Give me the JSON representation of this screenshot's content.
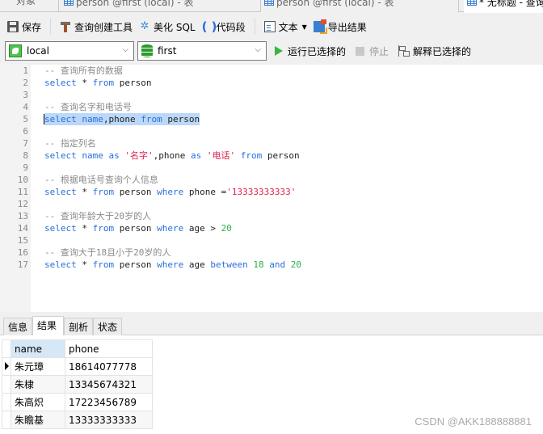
{
  "window_tabs": [
    {
      "label": "对象",
      "active": false
    },
    {
      "label": "person @first (local) - 表",
      "icon": "table-edit-icon",
      "active": false
    },
    {
      "label": "person @first (local) - 表",
      "icon": "table-icon",
      "active": false
    },
    {
      "label": "* 无标题 - 查询",
      "icon": "query-table-icon",
      "active": true
    }
  ],
  "toolbar": {
    "save": "保存",
    "query_builder": "查询创建工具",
    "beautify_sql": "美化 SQL",
    "code_snippet": "代码段",
    "text": "文本",
    "export_results": "导出结果"
  },
  "connection_bar": {
    "connection": "local",
    "database": "first",
    "run_selected": "运行已选择的",
    "stop": "停止",
    "explain_selected": "解释已选择的"
  },
  "editor": {
    "lines": [
      {
        "n": "1",
        "tokens": [
          {
            "t": "-- 查询所有的数据",
            "c": "cm"
          }
        ]
      },
      {
        "n": "2",
        "tokens": [
          {
            "t": "select",
            "c": "kw"
          },
          {
            "t": " * ",
            "c": "op"
          },
          {
            "t": "from",
            "c": "kw"
          },
          {
            "t": " person",
            "c": "id"
          }
        ]
      },
      {
        "n": "3",
        "tokens": []
      },
      {
        "n": "4",
        "tokens": [
          {
            "t": "-- 查询名字和电话号",
            "c": "cm"
          }
        ]
      },
      {
        "n": "5",
        "selected": true,
        "tokens": [
          {
            "t": "select",
            "c": "kw"
          },
          {
            "t": " ",
            "c": "op"
          },
          {
            "t": "name",
            "c": "kw"
          },
          {
            "t": ",phone ",
            "c": "id"
          },
          {
            "t": "from",
            "c": "kw"
          },
          {
            "t": " person",
            "c": "id"
          }
        ]
      },
      {
        "n": "6",
        "tokens": []
      },
      {
        "n": "7",
        "tokens": [
          {
            "t": "-- 指定列名",
            "c": "cm"
          }
        ]
      },
      {
        "n": "8",
        "tokens": [
          {
            "t": "select",
            "c": "kw"
          },
          {
            "t": " ",
            "c": "op"
          },
          {
            "t": "name",
            "c": "kw"
          },
          {
            "t": " ",
            "c": "op"
          },
          {
            "t": "as",
            "c": "kw"
          },
          {
            "t": " '名字'",
            "c": "st"
          },
          {
            "t": ",phone ",
            "c": "id"
          },
          {
            "t": "as",
            "c": "kw"
          },
          {
            "t": " '电话'",
            "c": "st"
          },
          {
            "t": " ",
            "c": "op"
          },
          {
            "t": "from",
            "c": "kw"
          },
          {
            "t": " person",
            "c": "id"
          }
        ]
      },
      {
        "n": "9",
        "tokens": []
      },
      {
        "n": "10",
        "tokens": [
          {
            "t": "-- 根据电话号查询个人信息",
            "c": "cm"
          }
        ]
      },
      {
        "n": "11",
        "tokens": [
          {
            "t": "select",
            "c": "kw"
          },
          {
            "t": " * ",
            "c": "op"
          },
          {
            "t": "from",
            "c": "kw"
          },
          {
            "t": " person ",
            "c": "id"
          },
          {
            "t": "where",
            "c": "kw"
          },
          {
            "t": " phone =",
            "c": "id"
          },
          {
            "t": "'13333333333'",
            "c": "st"
          }
        ]
      },
      {
        "n": "12",
        "tokens": []
      },
      {
        "n": "13",
        "tokens": [
          {
            "t": "-- 查询年龄大于20岁的人",
            "c": "cm"
          }
        ]
      },
      {
        "n": "14",
        "tokens": [
          {
            "t": "select",
            "c": "kw"
          },
          {
            "t": " * ",
            "c": "op"
          },
          {
            "t": "from",
            "c": "kw"
          },
          {
            "t": " person ",
            "c": "id"
          },
          {
            "t": "where",
            "c": "kw"
          },
          {
            "t": " age > ",
            "c": "id"
          },
          {
            "t": "20",
            "c": "num"
          }
        ]
      },
      {
        "n": "15",
        "tokens": []
      },
      {
        "n": "16",
        "tokens": [
          {
            "t": "-- 查询大于18且小于20岁的人",
            "c": "cm"
          }
        ]
      },
      {
        "n": "17",
        "tokens": [
          {
            "t": "select",
            "c": "kw"
          },
          {
            "t": " * ",
            "c": "op"
          },
          {
            "t": "from",
            "c": "kw"
          },
          {
            "t": " person ",
            "c": "id"
          },
          {
            "t": "where",
            "c": "kw"
          },
          {
            "t": " age ",
            "c": "id"
          },
          {
            "t": "between",
            "c": "kw"
          },
          {
            "t": " ",
            "c": "op"
          },
          {
            "t": "18",
            "c": "num"
          },
          {
            "t": " ",
            "c": "op"
          },
          {
            "t": "and",
            "c": "kw"
          },
          {
            "t": " ",
            "c": "op"
          },
          {
            "t": "20",
            "c": "num"
          }
        ]
      }
    ]
  },
  "result_tabs": [
    "信息",
    "结果 1",
    "剖析",
    "状态"
  ],
  "result_active_tab": "结果 1",
  "results": {
    "columns": [
      "name",
      "phone"
    ],
    "rows": [
      [
        "朱元璋",
        "18614077778"
      ],
      [
        "朱棣",
        "13345674321"
      ],
      [
        "朱高炽",
        "17223456789"
      ],
      [
        "朱瞻基",
        "13333333333"
      ]
    ],
    "current_row": 0
  },
  "watermark": "CSDN @AKK188888881"
}
